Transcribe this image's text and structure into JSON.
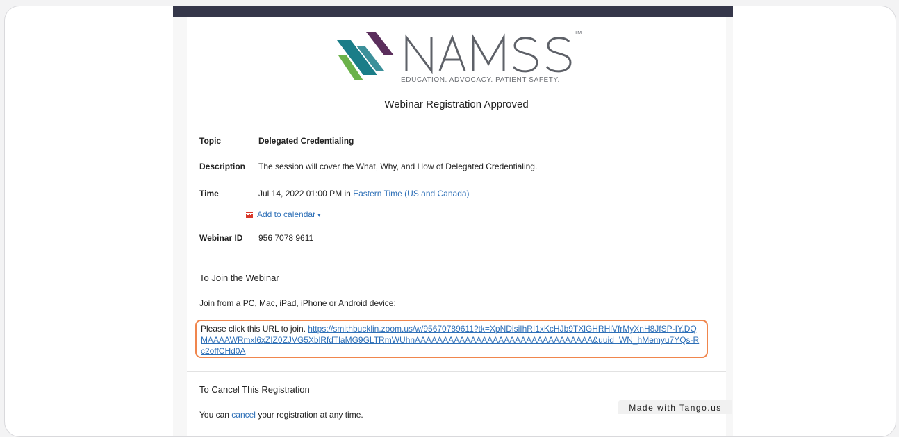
{
  "brand": {
    "name": "NAMSS",
    "trademark": "TM",
    "tagline": "EDUCATION. ADVOCACY. PATIENT SAFETY.",
    "colors": {
      "teal": "#1a7d88",
      "purple": "#5b2e5c",
      "green": "#6bb24a",
      "gray": "#6b6e73"
    }
  },
  "page_title": "Webinar Registration Approved",
  "details": {
    "topic": {
      "label": "Topic",
      "value": "Delegated Credentialing"
    },
    "description": {
      "label": "Description",
      "value": "The session will cover the What, Why, and How of Delegated Credentialing."
    },
    "time": {
      "label": "Time",
      "value": "Jul 14, 2022 01:00 PM",
      "connector": "in",
      "timezone": "Eastern Time (US and Canada)"
    },
    "add_to_calendar": "Add to calendar",
    "webinar_id": {
      "label": "Webinar ID",
      "value": "956 7078 9611"
    }
  },
  "join": {
    "heading": "To Join the Webinar",
    "devices": "Join from a PC, Mac, iPad, iPhone or Android device:",
    "url_prefix": "Please click this URL to join.",
    "url": "https://smithbucklin.zoom.us/w/95670789611?tk=XpNDisiIhRI1xKcHJb9TXlGHRHlVfrMyXnH8JfSP-IY.DQMAAAAWRmxl6xZIZ0ZJVG5XblRfdTlaMG9GLTRmWUhnAAAAAAAAAAAAAAAAAAAAAAAAAAAAAAAA&uuid=WN_hMemyu7YQs-Rc2offCHd0A"
  },
  "cancel": {
    "heading": "To Cancel This Registration",
    "prefix": "You can",
    "link": "cancel",
    "suffix": "your registration at any time."
  },
  "watermark": "Made with Tango.us"
}
